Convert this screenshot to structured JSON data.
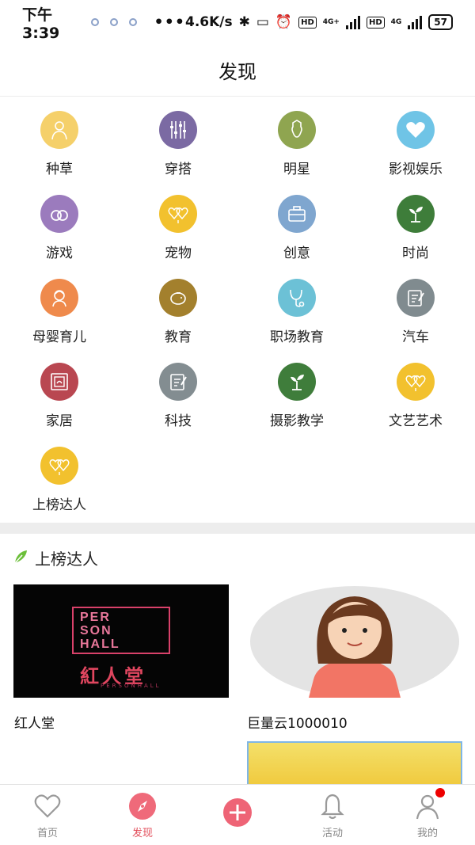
{
  "status_bar": {
    "time": "下午3:39",
    "more": "•••",
    "network_speed": "4.6K/s",
    "hd1": "HD",
    "hd2": "HD",
    "net1": "4G+",
    "net2": "4G",
    "battery": "57"
  },
  "header": {
    "title": "发现"
  },
  "categories": [
    {
      "label": "种草",
      "icon": "person-icon",
      "color": "#f5d06a"
    },
    {
      "label": "穿搭",
      "icon": "sliders-icon",
      "color": "#7b6aa3"
    },
    {
      "label": "明星",
      "icon": "face-icon",
      "color": "#8fa550"
    },
    {
      "label": "影视娱乐",
      "icon": "heart-icon",
      "color": "#6fc4e6"
    },
    {
      "label": "游戏",
      "icon": "rings-icon",
      "color": "#9b7bbd"
    },
    {
      "label": "宠物",
      "icon": "pet-hearts-icon",
      "color": "#f2c12e"
    },
    {
      "label": "创意",
      "icon": "briefcase-icon",
      "color": "#7fa6cf"
    },
    {
      "label": "时尚",
      "icon": "sprout-icon",
      "color": "#3e7d3a"
    },
    {
      "label": "母婴育儿",
      "icon": "baby-icon",
      "color": "#ef8a4c"
    },
    {
      "label": "教育",
      "icon": "piggy-bank-icon",
      "color": "#a3802d"
    },
    {
      "label": "职场教育",
      "icon": "stethoscope-icon",
      "color": "#6cc1d6"
    },
    {
      "label": "汽车",
      "icon": "notepad-icon",
      "color": "#808b8f"
    },
    {
      "label": "家居",
      "icon": "photo-frame-icon",
      "color": "#b94751"
    },
    {
      "label": "科技",
      "icon": "notepad-icon",
      "color": "#838d91"
    },
    {
      "label": "摄影教学",
      "icon": "sprout-icon",
      "color": "#3f7d3b"
    },
    {
      "label": "文艺艺术",
      "icon": "pet-hearts-icon",
      "color": "#f2c12e"
    },
    {
      "label": "上榜达人",
      "icon": "pet-hearts-icon",
      "color": "#f2c12e"
    }
  ],
  "section": {
    "title": "上榜达人",
    "icon": "leaf-icon"
  },
  "cards": [
    {
      "label": "红人堂",
      "logo_lines": [
        "PER",
        "SON",
        "HALL"
      ],
      "logo_cn": "紅人堂",
      "logo_sub": "PERSONHALL"
    },
    {
      "label": "巨量云1000010"
    }
  ],
  "nav": [
    {
      "label": "首页",
      "icon": "heart-outline-icon",
      "active": false
    },
    {
      "label": "发现",
      "icon": "compass-icon",
      "active": true
    },
    {
      "label": "",
      "icon": "plus-icon",
      "active": false
    },
    {
      "label": "活动",
      "icon": "bell-icon",
      "active": false
    },
    {
      "label": "我的",
      "icon": "user-icon",
      "active": false
    }
  ],
  "colors": {
    "accent": "#e24d5a",
    "divider": "#ededed"
  }
}
